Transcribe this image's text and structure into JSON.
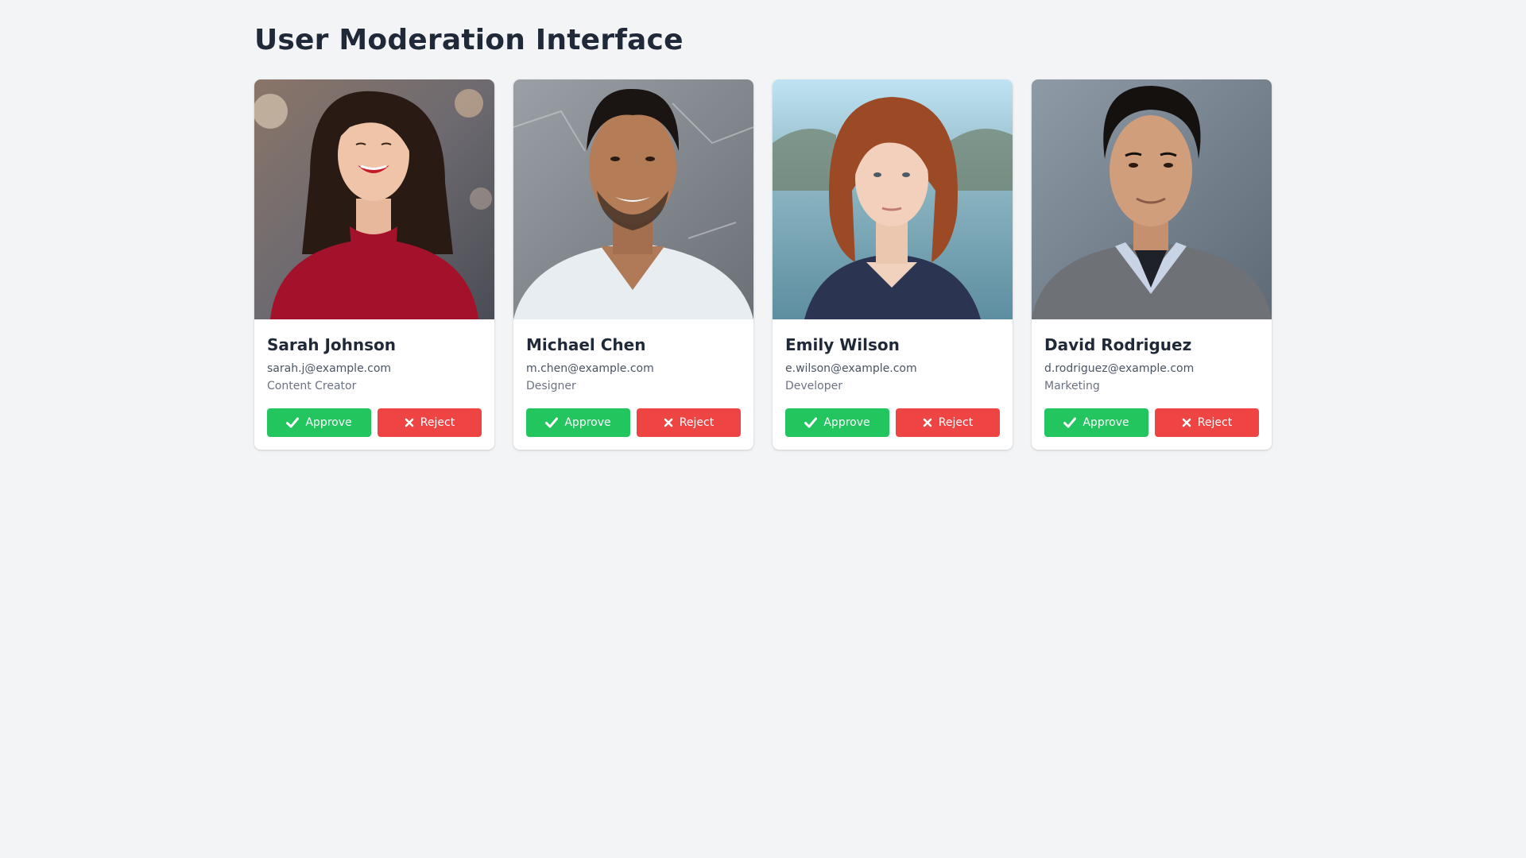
{
  "page": {
    "title": "User Moderation Interface"
  },
  "colors": {
    "approve": "#22c55e",
    "reject": "#ef4444",
    "background": "#f3f4f6",
    "text": "#1f2937"
  },
  "users": [
    {
      "name": "Sarah Johnson",
      "email": "sarah.j@example.com",
      "role": "Content Creator",
      "approve_label": "Approve",
      "reject_label": "Reject",
      "approve_icon": "check-icon",
      "reject_icon": "x-icon"
    },
    {
      "name": "Michael Chen",
      "email": "m.chen@example.com",
      "role": "Designer",
      "approve_label": "Approve",
      "reject_label": "Reject",
      "approve_icon": "check-icon",
      "reject_icon": "x-icon"
    },
    {
      "name": "Emily Wilson",
      "email": "e.wilson@example.com",
      "role": "Developer",
      "approve_label": "Approve",
      "reject_label": "Reject",
      "approve_icon": "check-icon",
      "reject_icon": "x-icon"
    },
    {
      "name": "David Rodriguez",
      "email": "d.rodriguez@example.com",
      "role": "Marketing",
      "approve_label": "Approve",
      "reject_label": "Reject",
      "approve_icon": "check-icon",
      "reject_icon": "x-icon"
    }
  ]
}
